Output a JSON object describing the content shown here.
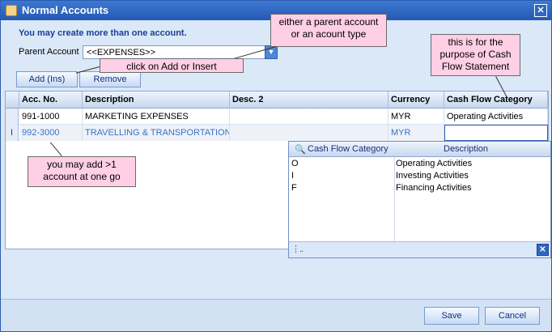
{
  "window": {
    "title": "Normal Accounts",
    "close_label": "✕"
  },
  "info_text": "You may create more than one account.",
  "parent_account": {
    "label": "Parent Account",
    "value": "<<EXPENSES>>"
  },
  "buttons": {
    "add": "Add  (Ins)",
    "remove": "Remove",
    "save": "Save",
    "cancel": "Cancel"
  },
  "grid": {
    "columns": [
      "Acc. No.",
      "Description",
      "Desc. 2",
      "Currency",
      "Cash Flow Category"
    ],
    "rows": [
      {
        "acc_no": "991-1000",
        "description": "MARKETING EXPENSES",
        "desc2": "",
        "currency": "MYR",
        "cash_flow": "Operating Activities"
      },
      {
        "acc_no": "992-3000",
        "description": "TRAVELLING & TRANSPORTATION",
        "desc2": "",
        "currency": "MYR",
        "cash_flow": ""
      }
    ],
    "edit_indicator": "I"
  },
  "dropdown": {
    "headers": [
      "Cash Flow Category",
      "Description"
    ],
    "items": [
      {
        "code": "O",
        "description": "Operating Activities"
      },
      {
        "code": "I",
        "description": "Investing Activities"
      },
      {
        "code": "F",
        "description": "Financing Activities"
      }
    ],
    "grip": "⋮..",
    "close_label": "✕"
  },
  "callouts": {
    "parent_hint_line1": "either a parent account",
    "parent_hint_line2": "or an acount type",
    "add_hint": "click on Add or Insert",
    "cashflow_hint_line1": "this is for the",
    "cashflow_hint_line2": "purpose of Cash",
    "cashflow_hint_line3": "Flow Statement",
    "multi_hint_line1": "you may add >1",
    "multi_hint_line2": "account at one go"
  },
  "colors": {
    "title_bar": "#2459b4",
    "callout_fill": "#ffcfe6",
    "dialog_bg": "#dbe8f8"
  },
  "icons": {
    "title_icon": "form-icon",
    "dropdown_header_icon": "binoculars-icon"
  }
}
